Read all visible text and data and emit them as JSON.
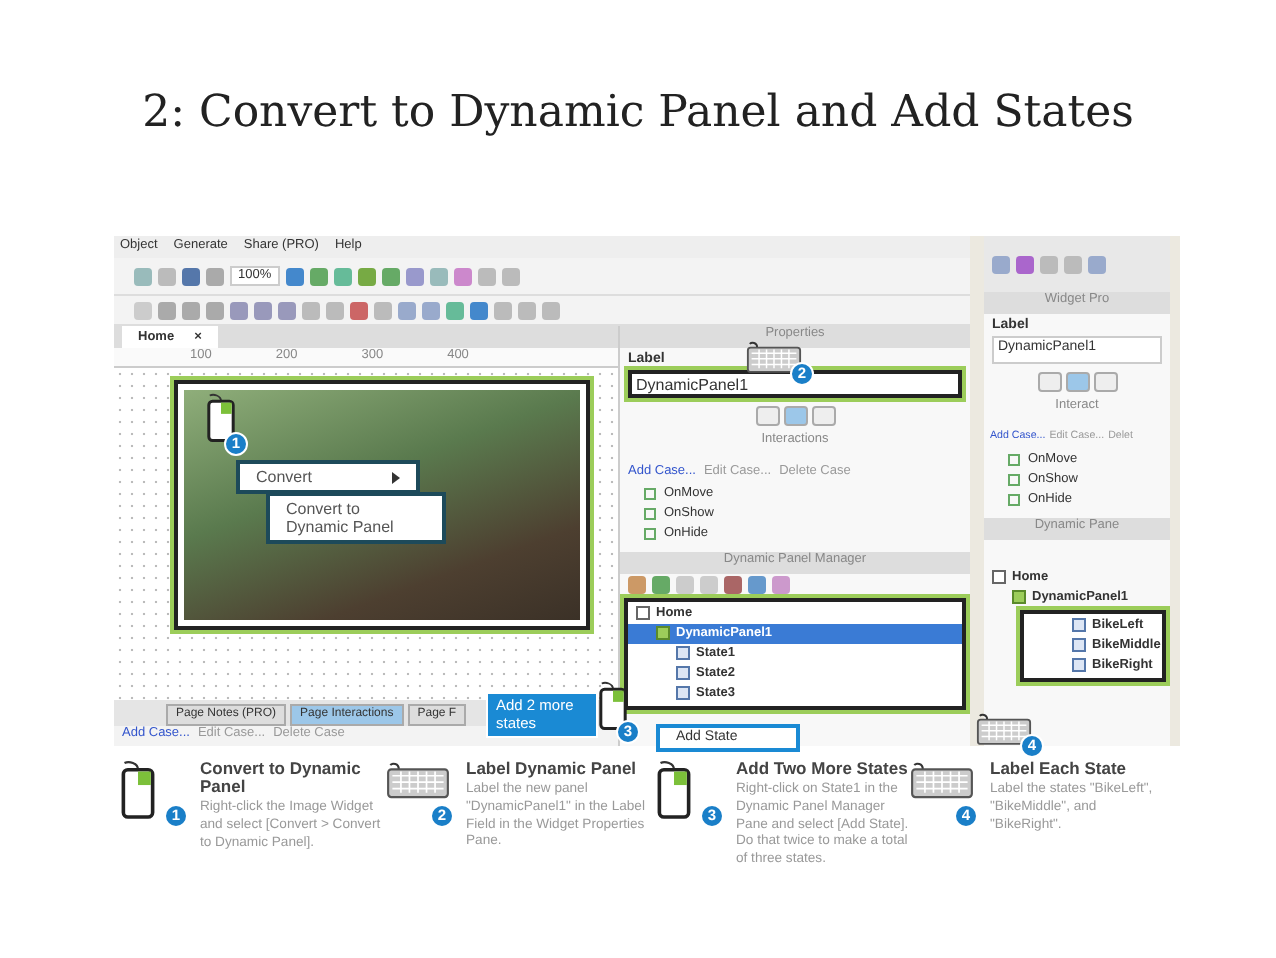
{
  "slide_title": "2: Convert to Dynamic Panel and Add States",
  "app": {
    "menu": [
      "Object",
      "Generate",
      "Share (PRO)",
      "Help"
    ],
    "zoom_value": "100%",
    "page_tab": {
      "label": "Home",
      "close": "×"
    },
    "ruler_ticks": [
      "100",
      "200",
      "300",
      "400"
    ],
    "context_menu": {
      "item": "Convert",
      "submenu_item": "Convert to Dynamic Panel"
    },
    "bottom_tabs": [
      {
        "label": "Page Notes (PRO)",
        "selected": false
      },
      {
        "label": "Page Interactions",
        "selected": true
      },
      {
        "label": "Page F",
        "selected": false
      }
    ],
    "case_links": [
      "Add Case...",
      "Edit Case...",
      "Delete Case"
    ],
    "properties": {
      "title": "Properties",
      "label_heading": "Label",
      "label_value": "DynamicPanel1",
      "section": "Interactions",
      "case_links": [
        "Add Case...",
        "Edit Case...",
        "Delete Case"
      ],
      "events": [
        "OnMove",
        "OnShow",
        "OnHide"
      ]
    },
    "manager": {
      "title": "Dynamic Panel Manager",
      "tree": [
        {
          "label": "Home",
          "kind": "page",
          "selected": false,
          "children": [
            {
              "label": "DynamicPanel1",
              "kind": "panel",
              "selected": true,
              "children": [
                {
                  "label": "State1",
                  "kind": "state",
                  "selected": false
                },
                {
                  "label": "State2",
                  "kind": "state",
                  "selected": false
                },
                {
                  "label": "State3",
                  "kind": "state",
                  "selected": false
                }
              ]
            }
          ]
        }
      ]
    },
    "callout": "Add 2 more states",
    "popup_item": "Add State",
    "markers": [
      {
        "number": "1",
        "kind": "mouse"
      },
      {
        "number": "2",
        "kind": "keyboard"
      },
      {
        "number": "3",
        "kind": "mouse"
      },
      {
        "number": "4",
        "kind": "keyboard"
      }
    ]
  },
  "right_panel": {
    "title": "Widget Pro",
    "label_heading": "Label",
    "label_value": "DynamicPanel1",
    "section": "Interact",
    "case_links": [
      "Add Case...",
      "Edit Case...",
      "Delet"
    ],
    "events": [
      "OnMove",
      "OnShow",
      "OnHide"
    ],
    "manager_title": "Dynamic Pane",
    "tree": [
      {
        "label": "Home",
        "kind": "page",
        "children": [
          {
            "label": "DynamicPanel1",
            "kind": "panel",
            "children": [
              {
                "label": "BikeLeft",
                "kind": "state"
              },
              {
                "label": "BikeMiddle",
                "kind": "state"
              },
              {
                "label": "BikeRight",
                "kind": "state"
              }
            ]
          }
        ]
      }
    ]
  },
  "steps": [
    {
      "number": "1",
      "kind": "mouse",
      "title": "Convert to Dynamic Panel",
      "text": "Right-click the Image Widget and select [Convert > Convert to Dynamic Panel]."
    },
    {
      "number": "2",
      "kind": "keyboard",
      "title": "Label Dynamic Panel",
      "text": "Label the new panel \"DynamicPanel1\" in the Label Field in the Widget Properties Pane."
    },
    {
      "number": "3",
      "kind": "mouse",
      "title": "Add Two More States",
      "text": "Right-click on State1 in the Dynamic Panel Manager Pane and select [Add State]. Do that twice to make a total of three states."
    },
    {
      "number": "4",
      "kind": "keyboard",
      "title": "Label Each State",
      "text": "Label the states \"BikeLeft\", \"BikeMiddle\", and \"BikeRight\"."
    }
  ]
}
